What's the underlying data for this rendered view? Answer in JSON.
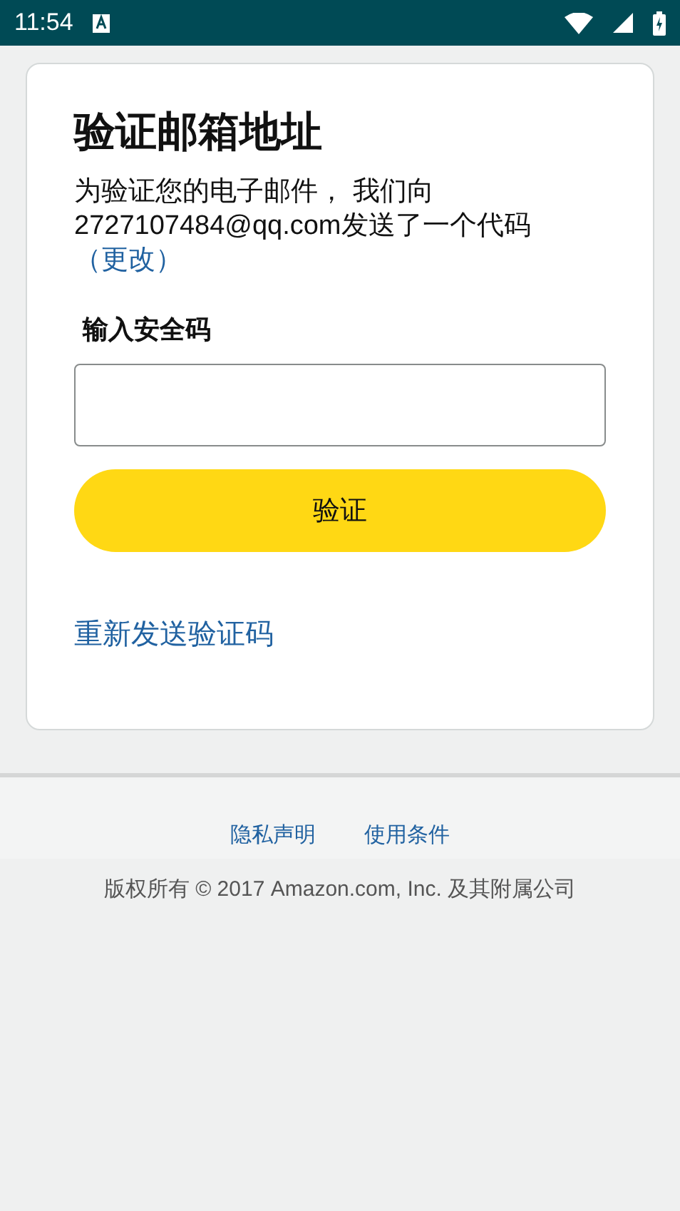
{
  "status_bar": {
    "time": "11:54"
  },
  "card": {
    "title": "验证邮箱地址",
    "description": "为验证您的电子邮件， 我们向 2727107484@qq.com发送了一个代码",
    "change_link": "（更改）",
    "code_label": "输入安全码",
    "verify_button": "验证",
    "resend_link": "重新发送验证码"
  },
  "footer": {
    "links": [
      "隐私声明",
      "使用条件"
    ],
    "copyright": "版权所有 © 2017 Amazon.com, Inc. 及其附属公司"
  }
}
